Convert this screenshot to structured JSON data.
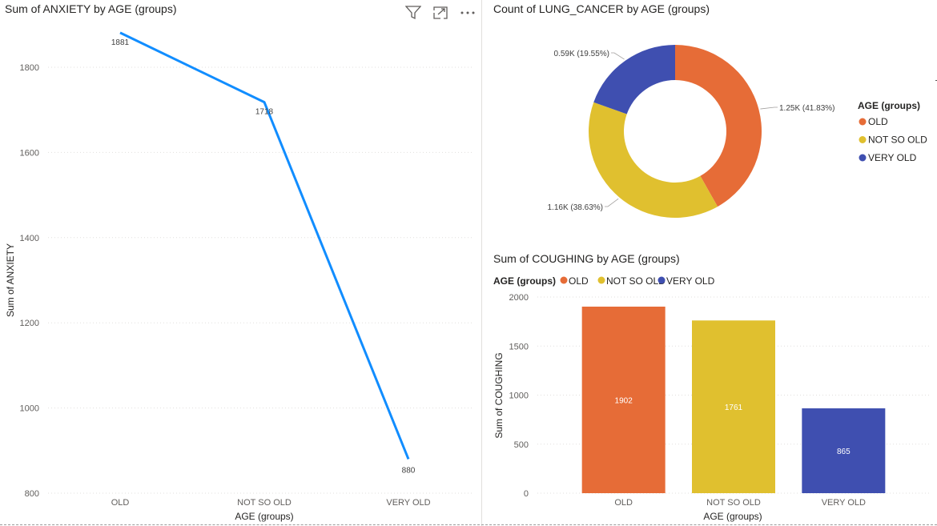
{
  "chart_data": [
    {
      "type": "line",
      "title": "Sum of ANXIETY by AGE (groups)",
      "xlabel": "AGE (groups)",
      "ylabel": "Sum of ANXIETY",
      "categories": [
        "OLD",
        "NOT SO OLD",
        "VERY OLD"
      ],
      "series": [
        {
          "values": [
            1881,
            1718,
            880
          ]
        }
      ],
      "data_labels": [
        "1881",
        "1718",
        "880"
      ],
      "ylim": [
        800,
        1900
      ],
      "yticks": [
        800,
        1000,
        1200,
        1400,
        1600,
        1800
      ],
      "grid": true,
      "color": "#118DFF"
    },
    {
      "type": "pie",
      "title": "Count of LUNG_CANCER by AGE (groups)",
      "donut": true,
      "legend_title": "AGE (groups)",
      "legend_position": "right",
      "categories": [
        "OLD",
        "NOT SO OLD",
        "VERY OLD"
      ],
      "values": [
        1250,
        1160,
        590
      ],
      "percent": [
        41.83,
        38.63,
        19.55
      ],
      "data_labels": [
        "1.25K (41.83%)",
        "1.16K (38.63%)",
        "0.59K (19.55%)"
      ],
      "colors": [
        "#E66C37",
        "#E0C02F",
        "#3F4FB0"
      ]
    },
    {
      "type": "bar",
      "title": "Sum of COUGHING by AGE (groups)",
      "xlabel": "AGE (groups)",
      "ylabel": "Sum of COUGHING",
      "legend_title": "AGE (groups)",
      "legend_position": "top-left",
      "categories": [
        "OLD",
        "NOT SO OLD",
        "VERY OLD"
      ],
      "values": [
        1902,
        1761,
        865
      ],
      "data_labels": [
        "1902",
        "1761",
        "865"
      ],
      "ylim": [
        0,
        2000
      ],
      "yticks": [
        0,
        500,
        1000,
        1500,
        2000
      ],
      "grid": true,
      "colors": [
        "#E66C37",
        "#E0C02F",
        "#3F4FB0"
      ]
    }
  ],
  "toolbar": {
    "icons": [
      "filter-icon",
      "focus-mode-icon",
      "more-options-icon"
    ]
  }
}
